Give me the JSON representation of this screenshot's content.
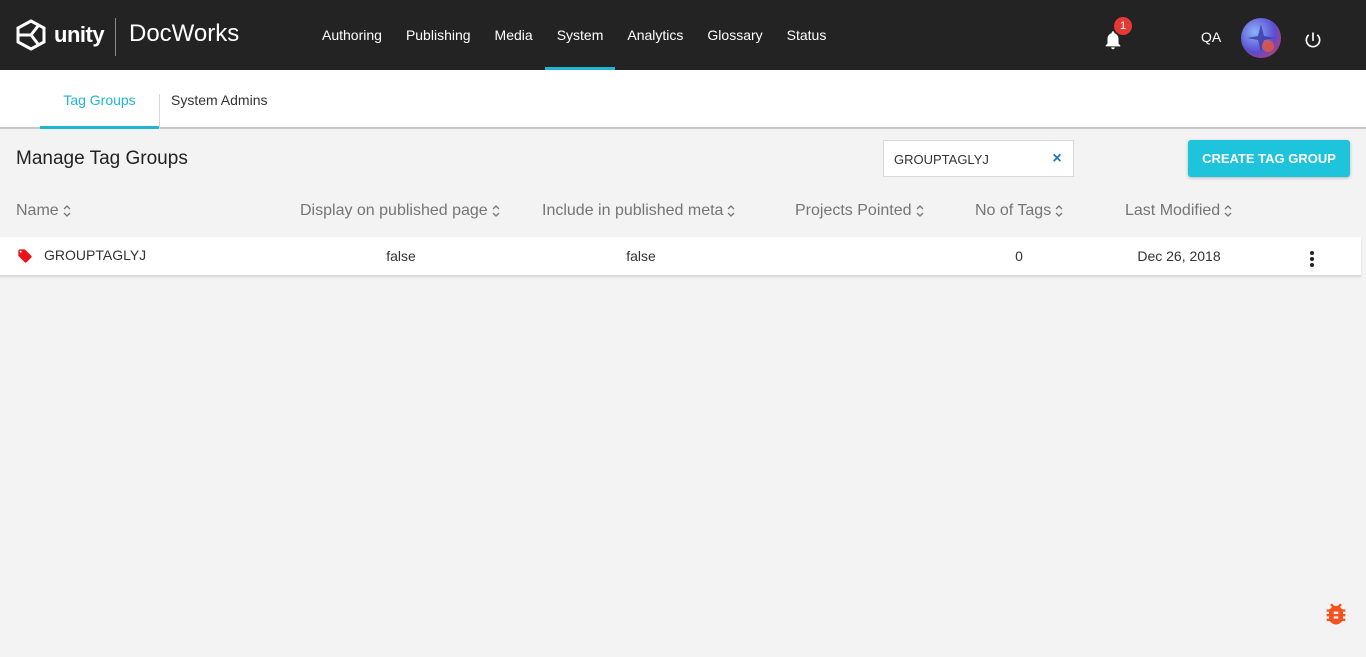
{
  "brand": {
    "logo_text": "unity",
    "app_title": "DocWorks"
  },
  "nav": [
    {
      "label": "Authoring"
    },
    {
      "label": "Publishing"
    },
    {
      "label": "Media"
    },
    {
      "label": "System",
      "active": true
    },
    {
      "label": "Analytics"
    },
    {
      "label": "Glossary"
    },
    {
      "label": "Status"
    }
  ],
  "header_right": {
    "notification_count": "1",
    "user_label": "QA",
    "icons": [
      "bell-icon",
      "avatar",
      "power-icon"
    ]
  },
  "subtabs": [
    {
      "label": "Tag Groups",
      "active": true
    },
    {
      "label": "System Admins"
    }
  ],
  "page": {
    "title": "Manage Tag Groups",
    "search_value": "GROUPTAGLYJ",
    "clear_symbol": "×",
    "create_button": "CREATE TAG GROUP"
  },
  "table": {
    "columns": [
      "Name",
      "Display on published page",
      "Include in published meta",
      "Projects Pointed",
      "No of Tags",
      "Last Modified"
    ],
    "rows": [
      {
        "name": "GROUPTAGLYJ",
        "display_on_published_page": "false",
        "include_in_published_meta": "false",
        "projects_pointed": "",
        "no_of_tags": "0",
        "last_modified": "Dec 26, 2018"
      }
    ]
  },
  "colors": {
    "topbar": "#232323",
    "accent": "#1fb6d2",
    "button": "#1ec3dc",
    "badge": "#e53935",
    "tag_icon": "#e8141b",
    "bug_icon": "#f4511e"
  }
}
